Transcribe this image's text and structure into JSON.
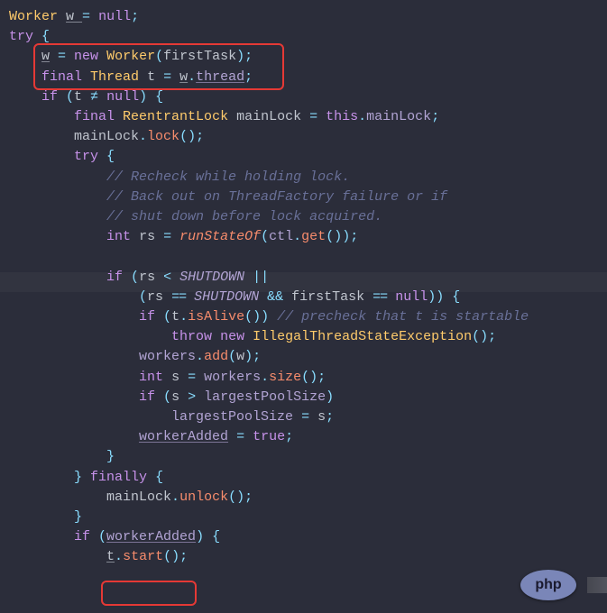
{
  "code": {
    "l1": {
      "t1": "Worker",
      "t2": "w ",
      "op": "=",
      "t3": " ",
      "kw": "null",
      "sc": ";"
    },
    "l2": {
      "kw": "try",
      "br": " {"
    },
    "l3": {
      "var": "w",
      "op": " = ",
      "kw": "new",
      "sp": " ",
      "type": "Worker",
      "lp": "(",
      "arg": "firstTask",
      "rp": ")",
      "sc": ";"
    },
    "l4": {
      "kw": "final",
      "sp": " ",
      "type": "Thread",
      "sp2": " ",
      "var": "t ",
      "op": "=",
      "sp3": " ",
      "obj": "w",
      "dot": ".",
      "fld": "thread",
      "sc": ";"
    },
    "l5": {
      "kw": "if",
      "lp": " (",
      "var": "t ",
      "op": "≠",
      "sp": " ",
      "nul": "null",
      "rp": ")",
      "br": " {"
    },
    "l6": {
      "kw": "final",
      "sp": " ",
      "type": "ReentrantLock",
      "sp2": " ",
      "var": "mainLock ",
      "op": "=",
      "sp3": " ",
      "this": "this",
      "dot": ".",
      "fld": "mainLock",
      "sc": ";"
    },
    "l7": {
      "obj": "mainLock",
      "dot": ".",
      "mth": "lock",
      "pr": "()",
      "sc": ";"
    },
    "l8": {
      "kw": "try",
      "br": " {"
    },
    "l9": {
      "c": "// Recheck while holding lock."
    },
    "l10": {
      "c": "// Back out on ThreadFactory failure or if"
    },
    "l11": {
      "c": "// shut down before lock acquired."
    },
    "l12": {
      "kw": "int",
      "sp": " ",
      "var": "rs ",
      "op": "=",
      "sp2": " ",
      "mth": "runStateOf",
      "lp": "(",
      "obj": "ctl",
      "dot": ".",
      "m2": "get",
      "pr": "()",
      "rp": ")",
      "sc": ";"
    },
    "l14": {
      "kw": "if",
      "lp": " (",
      "var": "rs ",
      "op": "<",
      "sp": " ",
      "st": "SHUTDOWN",
      "or": " ||"
    },
    "l15": {
      "lp": "(",
      "var": "rs ",
      "op1": "==",
      "sp": " ",
      "st": "SHUTDOWN",
      "and": " &&",
      "sp2": " ",
      "var2": "firstTask ",
      "op2": "==",
      "sp3": " ",
      "nul": "null",
      "rp": "))",
      "br": " {"
    },
    "l16": {
      "kw": "if",
      "lp": " (",
      "obj": "t",
      "dot": ".",
      "mth": "isAlive",
      "pr": "()",
      "rp": ")",
      "c": " // precheck that t is startable"
    },
    "l17": {
      "kw": "throw",
      "sp": " ",
      "kw2": "new",
      "sp2": " ",
      "type": "IllegalThreadStateException",
      "pr": "()",
      "sc": ";"
    },
    "l18": {
      "obj": "workers",
      "dot": ".",
      "mth": "add",
      "lp": "(",
      "arg": "w",
      "rp": ")",
      "sc": ";"
    },
    "l19": {
      "kw": "int",
      "sp": " ",
      "var": "s ",
      "op": "=",
      "sp2": " ",
      "obj": "workers",
      "dot": ".",
      "mth": "size",
      "pr": "()",
      "sc": ";"
    },
    "l20": {
      "kw": "if",
      "lp": " (",
      "var": "s ",
      "op": ">",
      "sp": " ",
      "fld": "largestPoolSize",
      "rp": ")"
    },
    "l21": {
      "fld": "largestPoolSize",
      "op": " = ",
      "var": "s",
      "sc": ";"
    },
    "l22": {
      "fld": "workerAdded",
      "op": " = ",
      "kw": "true",
      "sc": ";"
    },
    "l23": {
      "br": "}"
    },
    "l24": {
      "br": "}",
      "sp": " ",
      "kw": "finally",
      "br2": " {"
    },
    "l25": {
      "obj": "mainLock",
      "dot": ".",
      "mth": "unlock",
      "pr": "()",
      "sc": ";"
    },
    "l26": {
      "br": "}"
    },
    "l27": {
      "kw": "if",
      "lp": " (",
      "fld": "workerAdded",
      "rp": ")",
      "br": " {"
    },
    "l28": {
      "obj": "t",
      "dot": ".",
      "mth": "start",
      "pr": "()",
      "sc": ";"
    }
  },
  "badge": {
    "label": "php"
  }
}
